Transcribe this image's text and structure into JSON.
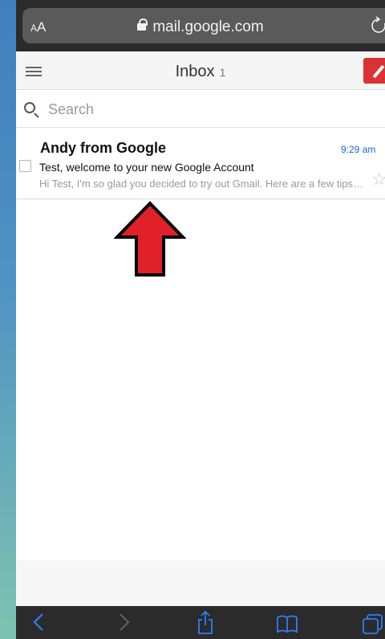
{
  "browser": {
    "text_size_label_small": "A",
    "text_size_label_large": "A",
    "url": "mail.google.com",
    "icons": [
      "lock-icon",
      "reload-icon",
      "back-icon",
      "forward-icon",
      "share-icon",
      "bookmarks-icon",
      "tabs-icon"
    ]
  },
  "header": {
    "title": "Inbox",
    "unread_count": "1",
    "menu_icon": "hamburger-icon",
    "compose_icon": "pencil-icon",
    "compose_color": "#db3236"
  },
  "search": {
    "placeholder": "Search"
  },
  "emails": [
    {
      "sender": "Andy from Google",
      "time": "9:29 am",
      "subject": "Test, welcome to your new Google Account",
      "snippet": "Hi Test, I'm so glad you decided to try out Gmail. Here are a few tips to get you up and running",
      "starred": false
    }
  ],
  "annotation": {
    "arrow_color": "#e0212a"
  },
  "colors": {
    "time_color": "#1a66d0",
    "safari_back_active": "#2f7df6"
  }
}
